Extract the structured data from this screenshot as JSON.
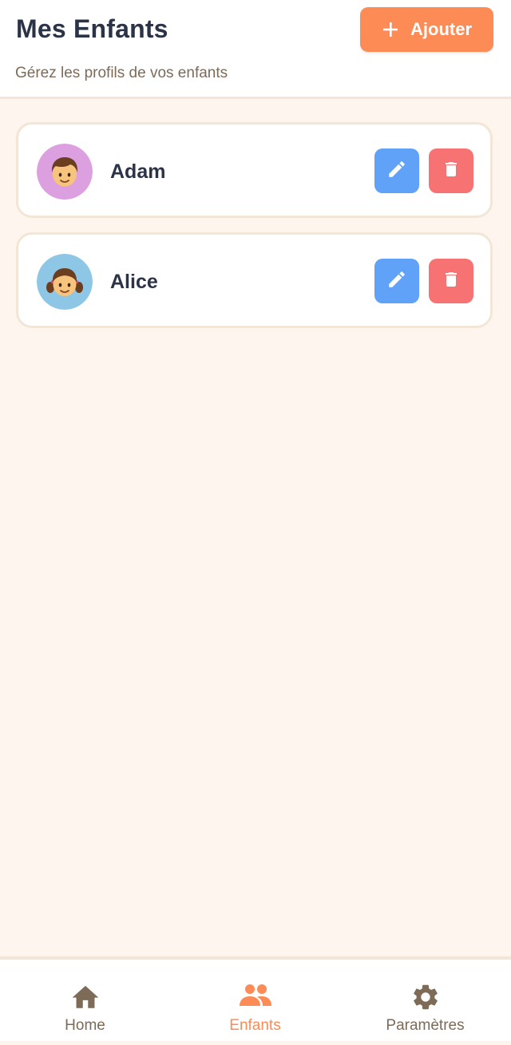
{
  "header": {
    "title": "Mes Enfants",
    "subtitle": "Gérez les profils de vos enfants",
    "add_button_label": "Ajouter",
    "add_icon": "plus-icon"
  },
  "children": [
    {
      "name": "Adam",
      "avatar_icon": "boy-avatar-icon",
      "avatar_color": "#dc9fe0"
    },
    {
      "name": "Alice",
      "avatar_icon": "girl-avatar-icon",
      "avatar_color": "#8ec6e6"
    }
  ],
  "actions": {
    "edit_icon": "pencil-icon",
    "delete_icon": "trash-icon"
  },
  "bottom_nav": {
    "items": [
      {
        "label": "Home",
        "icon": "home-icon",
        "active": false
      },
      {
        "label": "Enfants",
        "icon": "people-icon",
        "active": true
      },
      {
        "label": "Paramètres",
        "icon": "gear-icon",
        "active": false
      }
    ]
  },
  "colors": {
    "accent": "#fc8b55",
    "edit": "#5fa2f8",
    "delete": "#f77272",
    "background": "#fdf5ee",
    "text_primary": "#2b3347",
    "text_secondary": "#7d6a57"
  }
}
